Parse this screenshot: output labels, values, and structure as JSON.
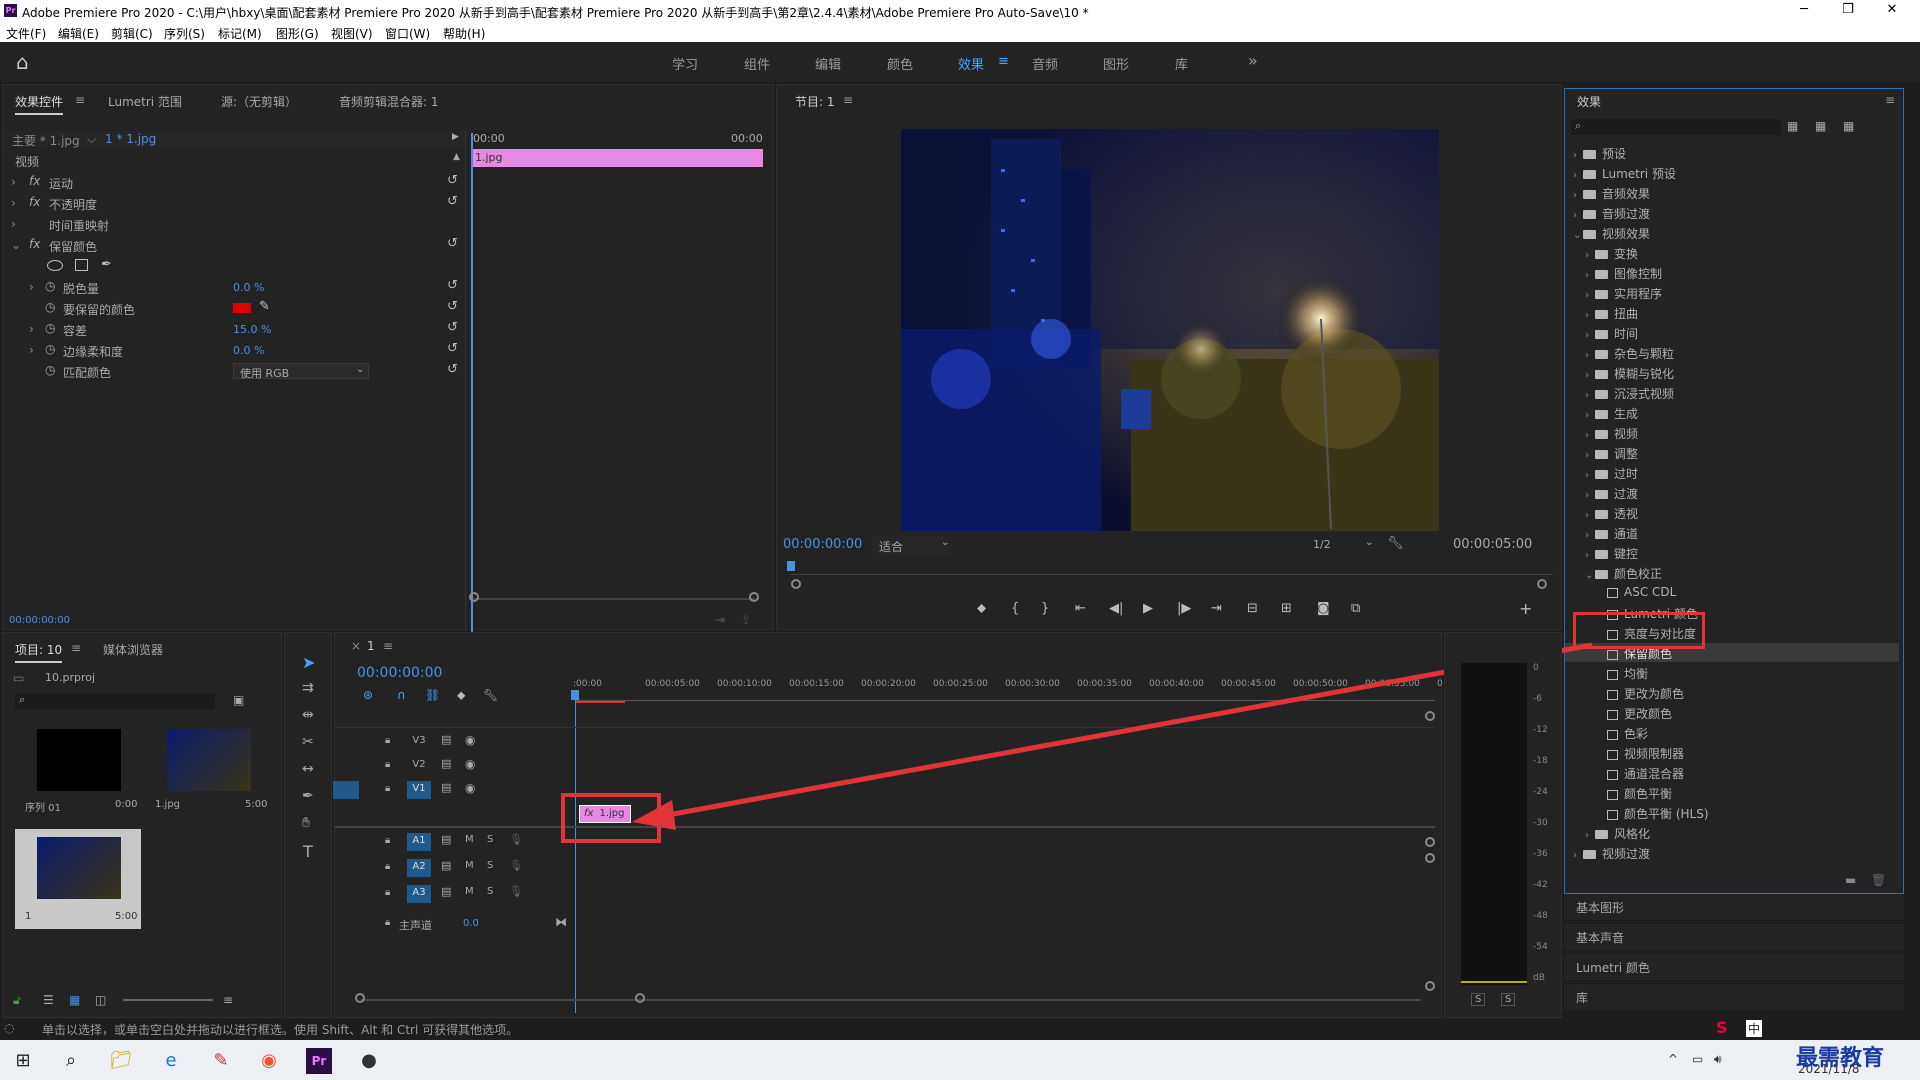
{
  "window": {
    "app_icon": "Pr",
    "title": "Adobe Premiere Pro 2020 - C:\\用户\\hbxy\\桌面\\配套素材 Premiere Pro 2020 从新手到高手\\配套素材 Premiere Pro 2020 从新手到高手\\第2章\\2.4.4\\素材\\Adobe Premiere Pro Auto-Save\\10 *",
    "min": "─",
    "max": "❐",
    "close": "✕"
  },
  "menu": [
    "文件(F)",
    "编辑(E)",
    "剪辑(C)",
    "序列(S)",
    "标记(M)",
    "图形(G)",
    "视图(V)",
    "窗口(W)",
    "帮助(H)"
  ],
  "workspaces": {
    "home": "⌂",
    "items": [
      "学习",
      "组件",
      "编辑",
      "颜色",
      "效果",
      "音频",
      "图形",
      "库"
    ],
    "active": "效果",
    "more": "»"
  },
  "effect_controls": {
    "tabs": [
      "效果控件",
      "Lumetri 范围",
      "源:（无剪辑）",
      "音频剪辑混合器: 1"
    ],
    "master": "主要 * 1.jpg",
    "clip": "1 * 1.jpg",
    "time_start": "00:00",
    "time_end": "00:00",
    "clip_bar": "1.jpg",
    "video_label": "视频",
    "rows": [
      {
        "label": "运动",
        "fx": "fx"
      },
      {
        "label": "不透明度",
        "fx": "fx"
      },
      {
        "label": "时间重映射",
        "fx": ""
      },
      {
        "label": "保留颜色",
        "fx": "fx"
      }
    ],
    "params": [
      {
        "label": "脱色量",
        "value": "0.0 %"
      },
      {
        "label": "要保留的颜色",
        "value": ""
      },
      {
        "label": "容差",
        "value": "15.0 %"
      },
      {
        "label": "边缘柔和度",
        "value": "0.0 %"
      },
      {
        "label": "匹配颜色",
        "value": "使用 RGB"
      }
    ],
    "color_swatch": "#e00000",
    "timecode": "00:00:00:00"
  },
  "program": {
    "title": "节目: 1",
    "timecode": "00:00:00:00",
    "fit": "适合",
    "resolution": "1/2",
    "duration": "00:00:05:00"
  },
  "effects": {
    "title": "效果",
    "items": [
      {
        "label": "预设",
        "type": "folder",
        "level": 0,
        "open": false
      },
      {
        "label": "Lumetri 预设",
        "type": "folder",
        "level": 0,
        "open": false
      },
      {
        "label": "音频效果",
        "type": "folder",
        "level": 0,
        "open": false
      },
      {
        "label": "音频过渡",
        "type": "folder",
        "level": 0,
        "open": false
      },
      {
        "label": "视频效果",
        "type": "folder",
        "level": 0,
        "open": true
      },
      {
        "label": "变换",
        "type": "folder",
        "level": 1,
        "open": false
      },
      {
        "label": "图像控制",
        "type": "folder",
        "level": 1,
        "open": false
      },
      {
        "label": "实用程序",
        "type": "folder",
        "level": 1,
        "open": false
      },
      {
        "label": "扭曲",
        "type": "folder",
        "level": 1,
        "open": false
      },
      {
        "label": "时间",
        "type": "folder",
        "level": 1,
        "open": false
      },
      {
        "label": "杂色与颗粒",
        "type": "folder",
        "level": 1,
        "open": false
      },
      {
        "label": "模糊与锐化",
        "type": "folder",
        "level": 1,
        "open": false
      },
      {
        "label": "沉浸式视频",
        "type": "folder",
        "level": 1,
        "open": false
      },
      {
        "label": "生成",
        "type": "folder",
        "level": 1,
        "open": false
      },
      {
        "label": "视频",
        "type": "folder",
        "level": 1,
        "open": false
      },
      {
        "label": "调整",
        "type": "folder",
        "level": 1,
        "open": false
      },
      {
        "label": "过时",
        "type": "folder",
        "level": 1,
        "open": false
      },
      {
        "label": "过渡",
        "type": "folder",
        "level": 1,
        "open": false
      },
      {
        "label": "透视",
        "type": "folder",
        "level": 1,
        "open": false
      },
      {
        "label": "通道",
        "type": "folder",
        "level": 1,
        "open": false
      },
      {
        "label": "键控",
        "type": "folder",
        "level": 1,
        "open": false
      },
      {
        "label": "颜色校正",
        "type": "folder",
        "level": 1,
        "open": true
      },
      {
        "label": "ASC CDL",
        "type": "fx",
        "level": 2
      },
      {
        "label": "Lumetri 颜色",
        "type": "fx",
        "level": 2
      },
      {
        "label": "亮度与对比度",
        "type": "fx",
        "level": 2
      },
      {
        "label": "保留颜色",
        "type": "fx",
        "level": 2,
        "selected": true
      },
      {
        "label": "均衡",
        "type": "fx",
        "level": 2
      },
      {
        "label": "更改为颜色",
        "type": "fx",
        "level": 2
      },
      {
        "label": "更改颜色",
        "type": "fx",
        "level": 2
      },
      {
        "label": "色彩",
        "type": "fx",
        "level": 2
      },
      {
        "label": "视频限制器",
        "type": "fx",
        "level": 2
      },
      {
        "label": "通道混合器",
        "type": "fx",
        "level": 2
      },
      {
        "label": "颜色平衡",
        "type": "fx",
        "level": 2
      },
      {
        "label": "颜色平衡 (HLS)",
        "type": "fx",
        "level": 2
      },
      {
        "label": "风格化",
        "type": "folder",
        "level": 1,
        "open": false
      },
      {
        "label": "视频过渡",
        "type": "folder",
        "level": 0,
        "open": false
      }
    ],
    "bottom_panels": [
      "基本图形",
      "基本声音",
      "Lumetri 颜色",
      "库"
    ]
  },
  "project": {
    "tabs": [
      "项目: 10",
      "媒体浏览器"
    ],
    "file": "10.prproj",
    "items": [
      {
        "name": "序列 01",
        "dur": "0:00"
      },
      {
        "name": "1.jpg",
        "dur": "5:00"
      },
      {
        "name": "1",
        "dur": "5:00"
      }
    ]
  },
  "timeline": {
    "tab": "1",
    "timecode": "00:00:00:00",
    "ruler": [
      ":00:00",
      "00:00:05:00",
      "00:00:10:00",
      "00:00:15:00",
      "00:00:20:00",
      "00:00:25:00",
      "00:00:30:00",
      "00:00:35:00",
      "00:00:40:00",
      "00:00:45:00",
      "00:00:50:00",
      "00:00:55:00",
      "0"
    ],
    "video_tracks": [
      "V3",
      "V2",
      "V1"
    ],
    "audio_tracks": [
      "A1",
      "A2",
      "A3"
    ],
    "master": "主声道",
    "master_val": "0.0",
    "clip": "1.jpg",
    "clip_fx": "fx"
  },
  "meter": {
    "scale": [
      "0",
      "-6",
      "-12",
      "-18",
      "-24",
      "-30",
      "-36",
      "-42",
      "-48",
      "-54",
      "dB"
    ],
    "solo": [
      "S",
      "S"
    ]
  },
  "status": "单击以选择，或单击空白处并拖动以进行框选。使用 Shift、Alt 和 Ctrl 可获得其他选项。",
  "taskbar": {
    "date": "2021/11/8",
    "watermark": "最需教育",
    "ime": "中"
  },
  "colors": {
    "accent": "#4aa3ff",
    "clip": "#e58ae0",
    "red": "#e0333a"
  }
}
